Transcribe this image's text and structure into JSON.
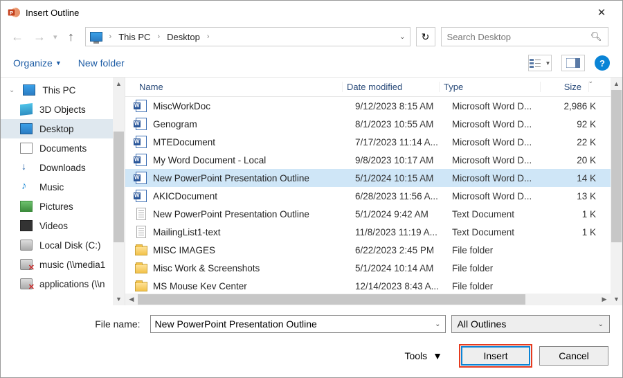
{
  "title": "Insert Outline",
  "breadcrumb": {
    "root": "This PC",
    "leaf": "Desktop"
  },
  "search": {
    "placeholder": "Search Desktop"
  },
  "toolbar": {
    "organize": "Organize",
    "newfolder": "New folder"
  },
  "columns": {
    "name": "Name",
    "date": "Date modified",
    "type": "Type",
    "size": "Size"
  },
  "sidebar": {
    "root": "This PC",
    "items": [
      {
        "label": "3D Objects"
      },
      {
        "label": "Desktop"
      },
      {
        "label": "Documents"
      },
      {
        "label": "Downloads"
      },
      {
        "label": "Music"
      },
      {
        "label": "Pictures"
      },
      {
        "label": "Videos"
      },
      {
        "label": "Local Disk (C:)"
      },
      {
        "label": "music (\\\\media1"
      },
      {
        "label": "applications (\\\\n"
      }
    ]
  },
  "files": [
    {
      "icon": "word",
      "name": "MiscWorkDoc",
      "date": "9/12/2023 8:15 AM",
      "type": "Microsoft Word D...",
      "size": "2,986 K"
    },
    {
      "icon": "word",
      "name": "Genogram",
      "date": "8/1/2023 10:55 AM",
      "type": "Microsoft Word D...",
      "size": "92 K"
    },
    {
      "icon": "word",
      "name": "MTEDocument",
      "date": "7/17/2023 11:14 A...",
      "type": "Microsoft Word D...",
      "size": "22 K"
    },
    {
      "icon": "word",
      "name": "My Word Document - Local",
      "date": "9/8/2023 10:17 AM",
      "type": "Microsoft Word D...",
      "size": "20 K"
    },
    {
      "icon": "word",
      "name": "New PowerPoint Presentation Outline",
      "date": "5/1/2024 10:15 AM",
      "type": "Microsoft Word D...",
      "size": "14 K",
      "selected": true
    },
    {
      "icon": "word",
      "name": "AKICDocument",
      "date": "6/28/2023 11:56 A...",
      "type": "Microsoft Word D...",
      "size": "13 K"
    },
    {
      "icon": "txt",
      "name": "New PowerPoint Presentation Outline",
      "date": "5/1/2024 9:42 AM",
      "type": "Text Document",
      "size": "1 K"
    },
    {
      "icon": "txt",
      "name": "MailingList1-text",
      "date": "11/8/2023 11:19 A...",
      "type": "Text Document",
      "size": "1 K"
    },
    {
      "icon": "folder",
      "name": "MISC IMAGES",
      "date": "6/22/2023 2:45 PM",
      "type": "File folder",
      "size": ""
    },
    {
      "icon": "folder",
      "name": "Misc Work & Screenshots",
      "date": "5/1/2024 10:14 AM",
      "type": "File folder",
      "size": ""
    },
    {
      "icon": "folder",
      "name": "MS Mouse Kev Center",
      "date": "12/14/2023 8:43 A...",
      "type": "File folder",
      "size": ""
    }
  ],
  "filename_label": "File name:",
  "filename_value": "New PowerPoint Presentation Outline",
  "filter_label": "All Outlines",
  "buttons": {
    "tools": "Tools",
    "insert": "Insert",
    "cancel": "Cancel"
  }
}
